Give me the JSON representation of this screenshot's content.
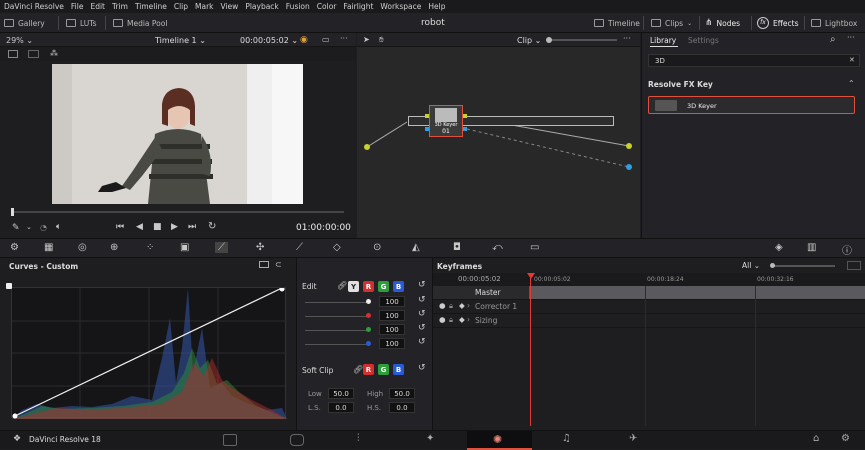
{
  "menu": [
    "DaVinci Resolve",
    "File",
    "Edit",
    "Trim",
    "Timeline",
    "Clip",
    "Mark",
    "View",
    "Playback",
    "Fusion",
    "Color",
    "Fairlight",
    "Workspace",
    "Help"
  ],
  "toolbar": {
    "gallery": "Gallery",
    "luts": "LUTs",
    "media_pool": "Media Pool",
    "project": "robot",
    "timeline": "Timeline",
    "clips": "Clips",
    "nodes": "Nodes",
    "effects": "Effects",
    "lightbox": "Lightbox"
  },
  "viewer": {
    "zoom": "29%",
    "timeline": "Timeline 1",
    "timecode": "00:00:05:02",
    "playhead_tc": "01:00:00:00",
    "scrub_progress": 0.0
  },
  "nodes": {
    "mode": "Clip",
    "node_label": "3D Keyer",
    "node_number": "01"
  },
  "library": {
    "tab_library": "Library",
    "tab_settings": "Settings",
    "search_value": "3D",
    "section": "Resolve FX Key",
    "item": "3D Keyer"
  },
  "curves": {
    "title": "Curves - Custom"
  },
  "edit": {
    "label": "Edit",
    "channels": [
      "Y",
      "R",
      "G",
      "B"
    ],
    "values": [
      "100",
      "100",
      "100",
      "100"
    ],
    "soft_clip": "Soft Clip",
    "low_label": "Low",
    "low_value": "50.0",
    "high_label": "High",
    "high_value": "50.0",
    "ls_label": "L.S.",
    "ls_value": "0.0",
    "hs_label": "H.S.",
    "hs_value": "0.0"
  },
  "keyframes": {
    "title": "Keyframes",
    "filter": "All",
    "timecode": "00:00:05:02",
    "ruler": [
      "00:00:05:02",
      "00:00:18:24",
      "00:00:32:16"
    ],
    "tracks": [
      "Master",
      "Corrector 1",
      "Sizing"
    ]
  },
  "footer": {
    "app": "DaVinci Resolve 18"
  },
  "colors": {
    "accent": "#e0503a",
    "playhead": "#e53935",
    "red": "#d32f2f",
    "green": "#2e9e3c",
    "blue": "#2a5bd7"
  }
}
